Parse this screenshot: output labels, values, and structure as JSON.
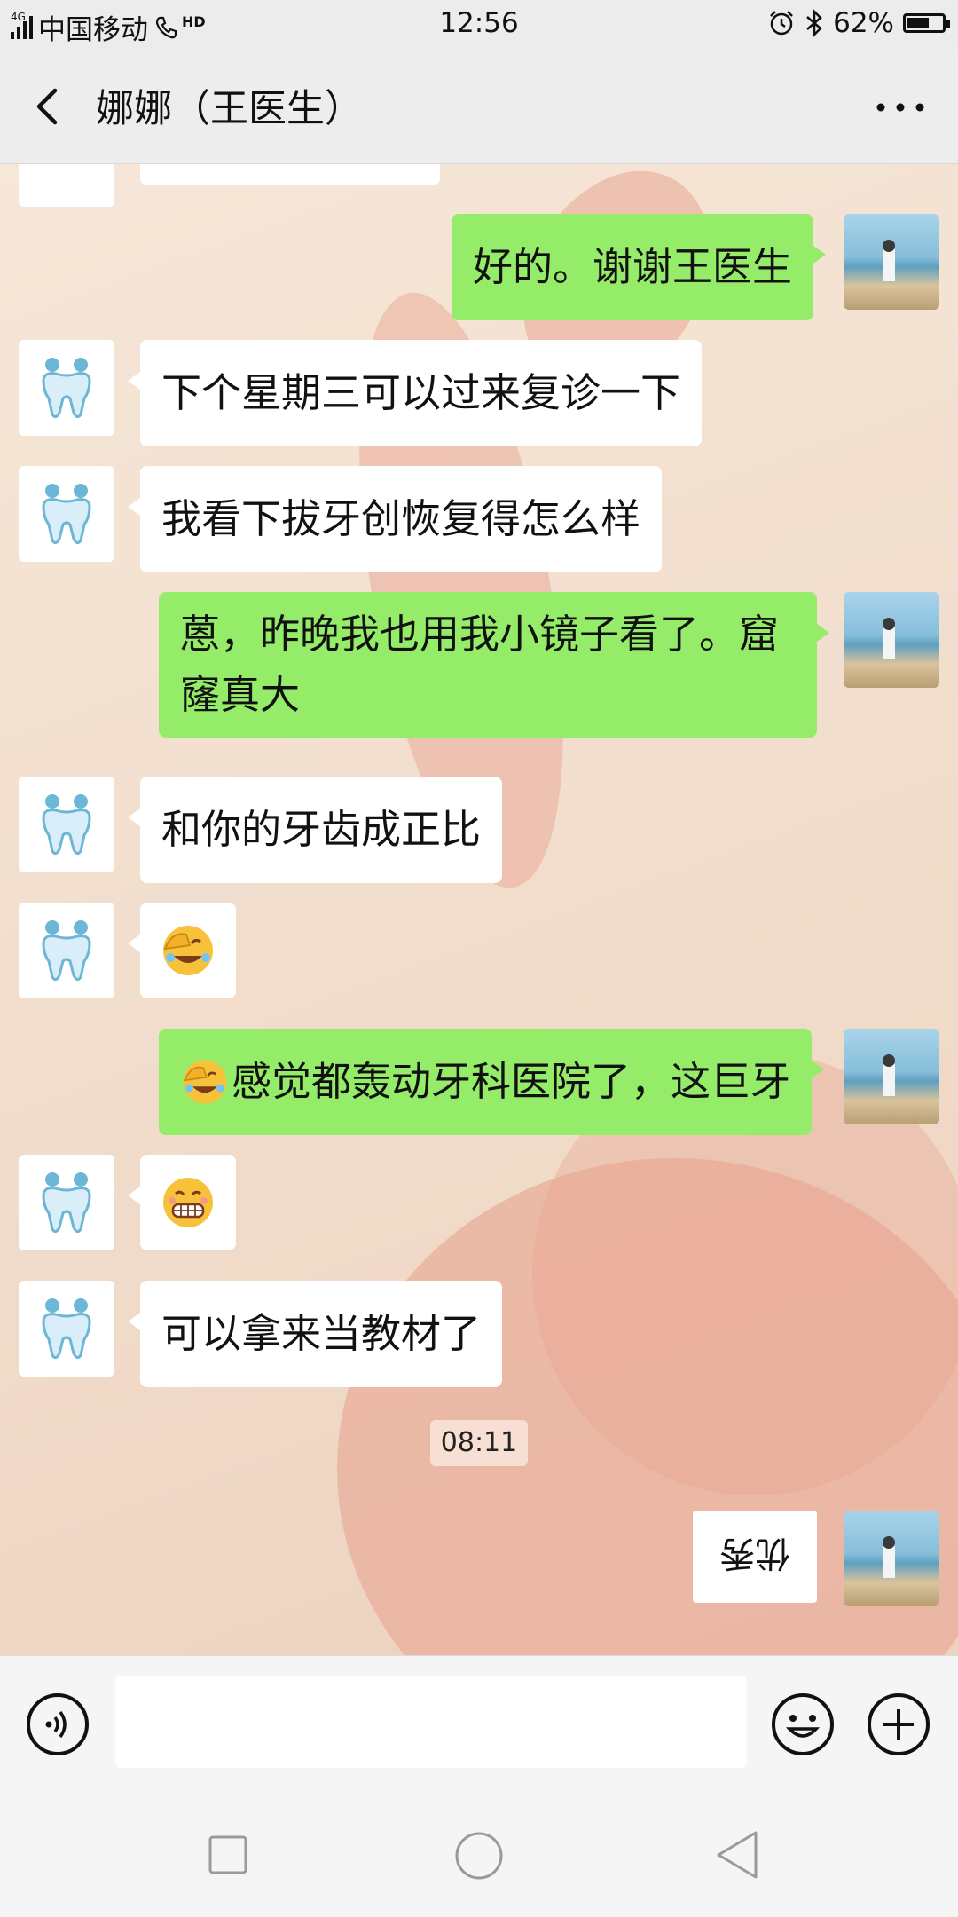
{
  "status_bar": {
    "network_tag": "4G",
    "carrier": "中国移动",
    "hd_label": "HD",
    "time": "12:56",
    "battery_text": "62%",
    "battery_level": 0.62
  },
  "header": {
    "title": "娜娜（王医生）"
  },
  "messages": [
    {
      "side": "out",
      "text": "好的。谢谢王医生"
    },
    {
      "side": "in",
      "text": "下个星期三可以过来复诊一下"
    },
    {
      "side": "in",
      "text": "我看下拔牙创恢复得怎么样"
    },
    {
      "side": "out",
      "text": "蒽，昨晚我也用我小镜子看了。窟窿真大"
    },
    {
      "side": "in",
      "text": "和你的牙齿成正比"
    },
    {
      "side": "in",
      "emoji": "facepalm-laugh"
    },
    {
      "side": "out",
      "text": "感觉都轰动牙科医院了，这巨牙",
      "emoji": "facepalm-laugh"
    },
    {
      "side": "in",
      "emoji": "grimace"
    },
    {
      "side": "in",
      "text": "可以拿来当教材了"
    }
  ],
  "timestamp": "08:11",
  "image_message": {
    "text": "优秀"
  },
  "colors": {
    "outgoing_bubble": "#95ec69",
    "incoming_bubble": "#ffffff",
    "header_bg": "#ededed"
  },
  "icons": {
    "back": "chevron-left-icon",
    "more": "more-dots-icon",
    "voice": "voice-icon",
    "emoji": "emoji-icon",
    "plus": "plus-icon",
    "doctor_avatar": "tooth-icon"
  }
}
